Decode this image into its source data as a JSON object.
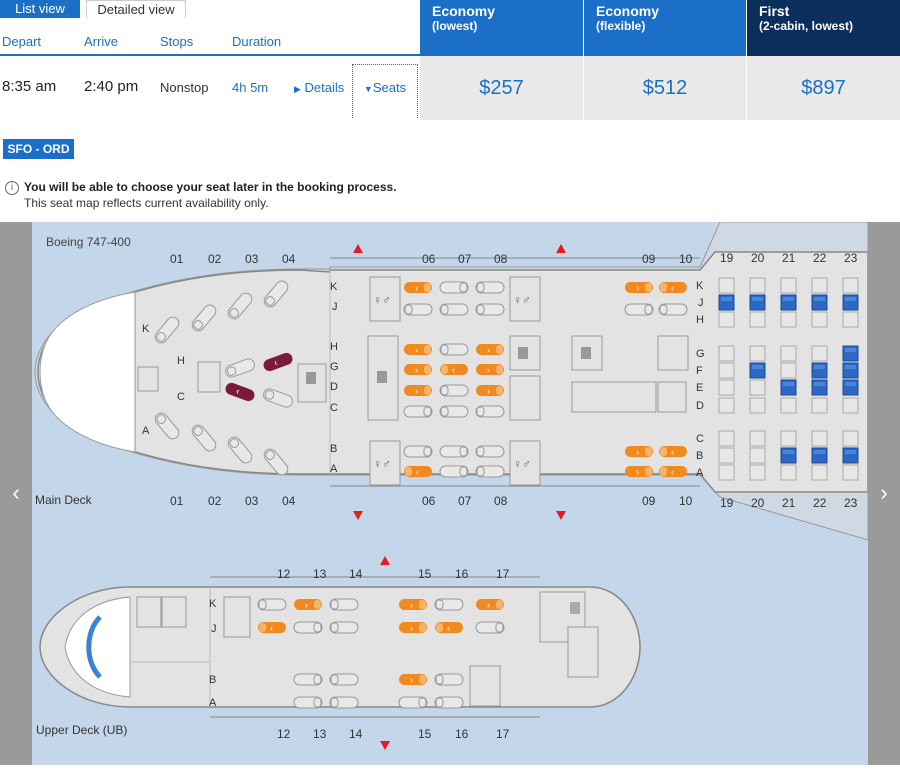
{
  "tabs": {
    "list_view": "List view",
    "detailed_view": "Detailed view"
  },
  "columns": {
    "depart": "Depart",
    "arrive": "Arrive",
    "stops": "Stops",
    "duration": "Duration"
  },
  "fares": [
    {
      "title": "Economy",
      "subtitle": "(lowest)",
      "price": "$257",
      "color": "#1b6fc6"
    },
    {
      "title": "Economy",
      "subtitle": "(flexible)",
      "price": "$512",
      "color": "#1b6fc6"
    },
    {
      "title": "First",
      "subtitle": "(2-cabin, lowest)",
      "price": "$897",
      "color": "#0a2f5c"
    }
  ],
  "flight": {
    "depart": "8:35 am",
    "arrive": "2:40 pm",
    "stops": "Nonstop",
    "duration": "4h 5m",
    "details_label": "Details",
    "seats_label": "Seats"
  },
  "route_badge": "SFO - ORD",
  "info": {
    "line1": "You will be able to choose your seat later in the booking process.",
    "line2": "This seat map reflects current availability only."
  },
  "seatmap": {
    "aircraft": "Boeing 747-400",
    "main_deck_label": "Main Deck",
    "upper_deck_label": "Upper Deck (UB)",
    "main_rows_first": [
      "01",
      "02",
      "03",
      "04"
    ],
    "main_rows_business": [
      "06",
      "07",
      "08"
    ],
    "main_rows_business2": [
      "09",
      "10"
    ],
    "main_rows_economy": [
      "19",
      "20",
      "21",
      "22",
      "23"
    ],
    "upper_rows_a": [
      "12",
      "13",
      "14"
    ],
    "upper_rows_b": [
      "15",
      "16",
      "17"
    ],
    "letters_first_k": "K",
    "letters_first_h": "H",
    "letters_first_c": "C",
    "letters_first_a": "A",
    "letters_biz": [
      "K",
      "J",
      "H",
      "G",
      "D",
      "C",
      "B",
      "A"
    ],
    "letters_economy": [
      "K",
      "J",
      "H",
      "G",
      "F",
      "E",
      "D",
      "C",
      "B",
      "A"
    ],
    "letters_upper": [
      "K",
      "J",
      "B",
      "A"
    ],
    "colors": {
      "available_orange": "#f08a1e",
      "occupied": "#c7c7c7",
      "first_available": "#7a1b3a",
      "economy_available": "#2d68c4",
      "fuselage": "#e3e3e3",
      "sky": "#c4d6ea"
    }
  }
}
